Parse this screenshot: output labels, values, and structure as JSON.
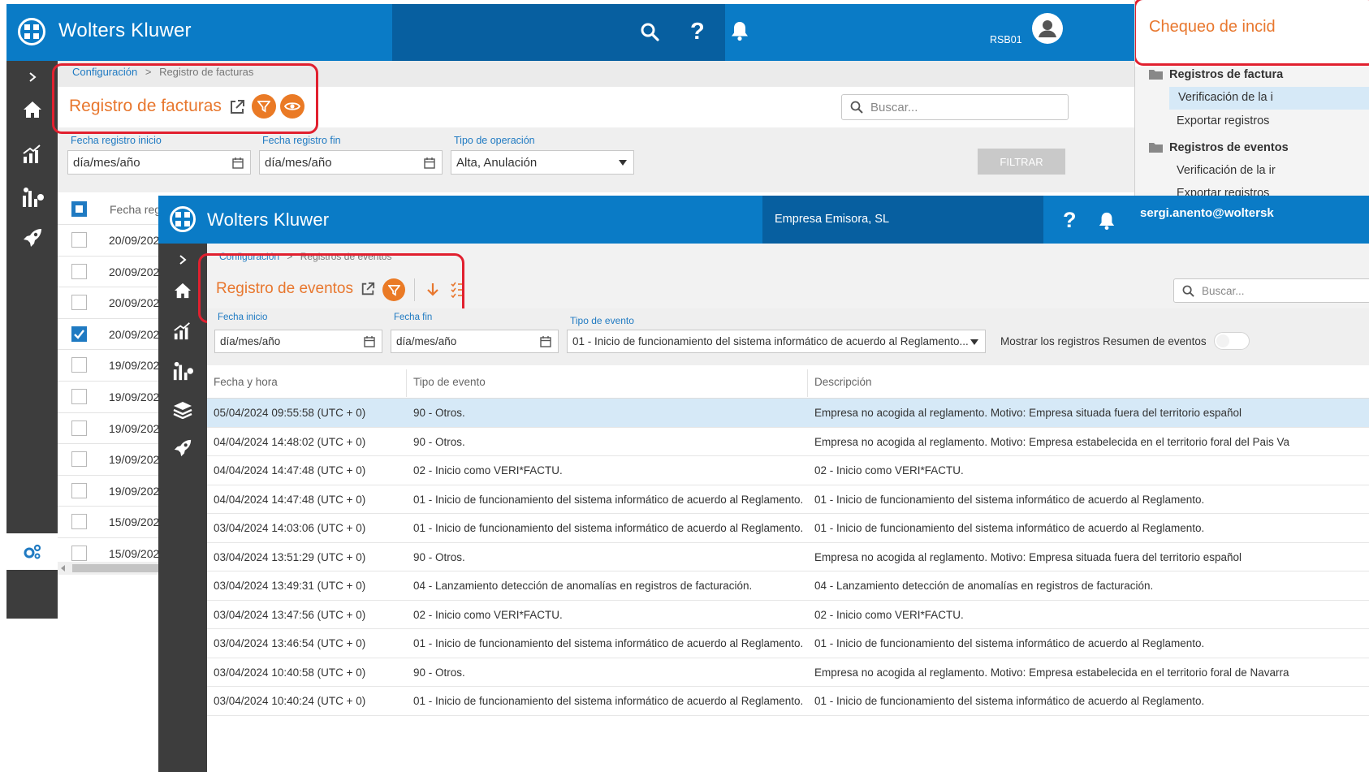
{
  "back_window": {
    "brand": "Wolters Kluwer",
    "user_code": "RSB01",
    "breadcrumb": {
      "parent": "Configuración",
      "separator": ">",
      "current": "Registro de facturas"
    },
    "title": "Registro de facturas",
    "search_placeholder": "Buscar...",
    "filters": {
      "fecha_inicio_label": "Fecha registro inicio",
      "fecha_inicio_value": "día/mes/año",
      "fecha_fin_label": "Fecha registro fin",
      "fecha_fin_value": "día/mes/año",
      "tipo_label": "Tipo de operación",
      "tipo_value": "Alta, Anulación",
      "filtrar_label": "FILTRAR"
    },
    "table": {
      "col_header": "Fecha reg",
      "rows": [
        {
          "date": "20/09/202",
          "checked": false
        },
        {
          "date": "20/09/202",
          "checked": false
        },
        {
          "date": "20/09/202",
          "checked": false
        },
        {
          "date": "20/09/202",
          "checked": true
        },
        {
          "date": "19/09/202",
          "checked": false
        },
        {
          "date": "19/09/202",
          "checked": false
        },
        {
          "date": "19/09/202",
          "checked": false
        },
        {
          "date": "19/09/202",
          "checked": false
        },
        {
          "date": "19/09/202",
          "checked": false
        },
        {
          "date": "15/09/202",
          "checked": false
        },
        {
          "date": "15/09/202",
          "checked": false
        }
      ]
    }
  },
  "right_panel": {
    "title": "Chequeo de incid",
    "items": [
      {
        "label": "Registros de factura",
        "kind": "folder"
      },
      {
        "label": "Verificación de la i",
        "kind": "selected"
      },
      {
        "label": "Exportar registros",
        "kind": "leaf"
      },
      {
        "label": "Registros de eventos",
        "kind": "folder"
      },
      {
        "label": "Verificación de la ir",
        "kind": "leaf"
      },
      {
        "label": "Exportar registros",
        "kind": "leaf"
      }
    ]
  },
  "front_window": {
    "brand": "Wolters Kluwer",
    "company": "Empresa Emisora, SL",
    "user_email": "sergi.anento@woltersk",
    "breadcrumb": {
      "parent": "Configuración",
      "separator": ">",
      "current": "Registros de eventos"
    },
    "title": "Registro de eventos",
    "search_placeholder": "Buscar...",
    "filters": {
      "fecha_inicio_label": "Fecha inicio",
      "fecha_inicio_value": "día/mes/año",
      "fecha_fin_label": "Fecha fin",
      "fecha_fin_value": "día/mes/año",
      "tipo_label": "Tipo de evento",
      "tipo_value": "01 - Inicio de funcionamiento del sistema informático de acuerdo al Reglamento...",
      "toggle_label": "Mostrar los registros Resumen de eventos",
      "toggle_on": false
    },
    "table": {
      "headers": [
        "Fecha y hora",
        "Tipo de evento",
        "Descripción"
      ],
      "rows": [
        {
          "fecha": "05/04/2024 09:55:58 (UTC + 0)",
          "tipo": "90 - Otros.",
          "desc": "Empresa no acogida al reglamento. Motivo: Empresa situada fuera del territorio español",
          "selected": true
        },
        {
          "fecha": "04/04/2024 14:48:02 (UTC + 0)",
          "tipo": "90 - Otros.",
          "desc": "Empresa no acogida al reglamento. Motivo: Empresa estabelecida en el territorio foral del Pais Va",
          "selected": false
        },
        {
          "fecha": "04/04/2024 14:47:48 (UTC + 0)",
          "tipo": "02 - Inicio como VERI*FACTU.",
          "desc": "02 - Inicio como VERI*FACTU.",
          "selected": false
        },
        {
          "fecha": "04/04/2024 14:47:48 (UTC + 0)",
          "tipo": "01 - Inicio de funcionamiento del sistema informático de acuerdo al Reglamento.",
          "desc": "01 - Inicio de funcionamiento del sistema informático de acuerdo al Reglamento.",
          "selected": false
        },
        {
          "fecha": "03/04/2024 14:03:06 (UTC + 0)",
          "tipo": "01 - Inicio de funcionamiento del sistema informático de acuerdo al Reglamento.",
          "desc": "01 - Inicio de funcionamiento del sistema informático de acuerdo al Reglamento.",
          "selected": false
        },
        {
          "fecha": "03/04/2024 13:51:29 (UTC + 0)",
          "tipo": "90 - Otros.",
          "desc": "Empresa no acogida al reglamento. Motivo: Empresa situada fuera del territorio español",
          "selected": false
        },
        {
          "fecha": "03/04/2024 13:49:31 (UTC + 0)",
          "tipo": "04 - Lanzamiento detección de anomalías en registros de facturación.",
          "desc": "04 - Lanzamiento detección de anomalías en registros de facturación.",
          "selected": false
        },
        {
          "fecha": "03/04/2024 13:47:56 (UTC + 0)",
          "tipo": "02 - Inicio como VERI*FACTU.",
          "desc": "02 - Inicio como VERI*FACTU.",
          "selected": false
        },
        {
          "fecha": "03/04/2024 13:46:54 (UTC + 0)",
          "tipo": "01 - Inicio de funcionamiento del sistema informático de acuerdo al Reglamento.",
          "desc": "01 - Inicio de funcionamiento del sistema informático de acuerdo al Reglamento.",
          "selected": false
        },
        {
          "fecha": "03/04/2024 10:40:58 (UTC + 0)",
          "tipo": "90 - Otros.",
          "desc": "Empresa no acogida al reglamento. Motivo: Empresa estabelecida en el territorio foral de Navarra",
          "selected": false
        },
        {
          "fecha": "03/04/2024 10:40:24 (UTC + 0)",
          "tipo": "01 - Inicio de funcionamiento del sistema informático de acuerdo al Reglamento.",
          "desc": "01 - Inicio de funcionamiento del sistema informático de acuerdo al Reglamento.",
          "selected": false
        }
      ]
    }
  },
  "colors": {
    "header_blue": "#0a7bc6",
    "header_dark_blue": "#075fa0",
    "sidebar": "#3d3d3d",
    "accent_orange": "#e8772e",
    "link_blue": "#1f7ac2",
    "selected_row": "#d6e9f7",
    "annotation_red": "#e1202f"
  }
}
